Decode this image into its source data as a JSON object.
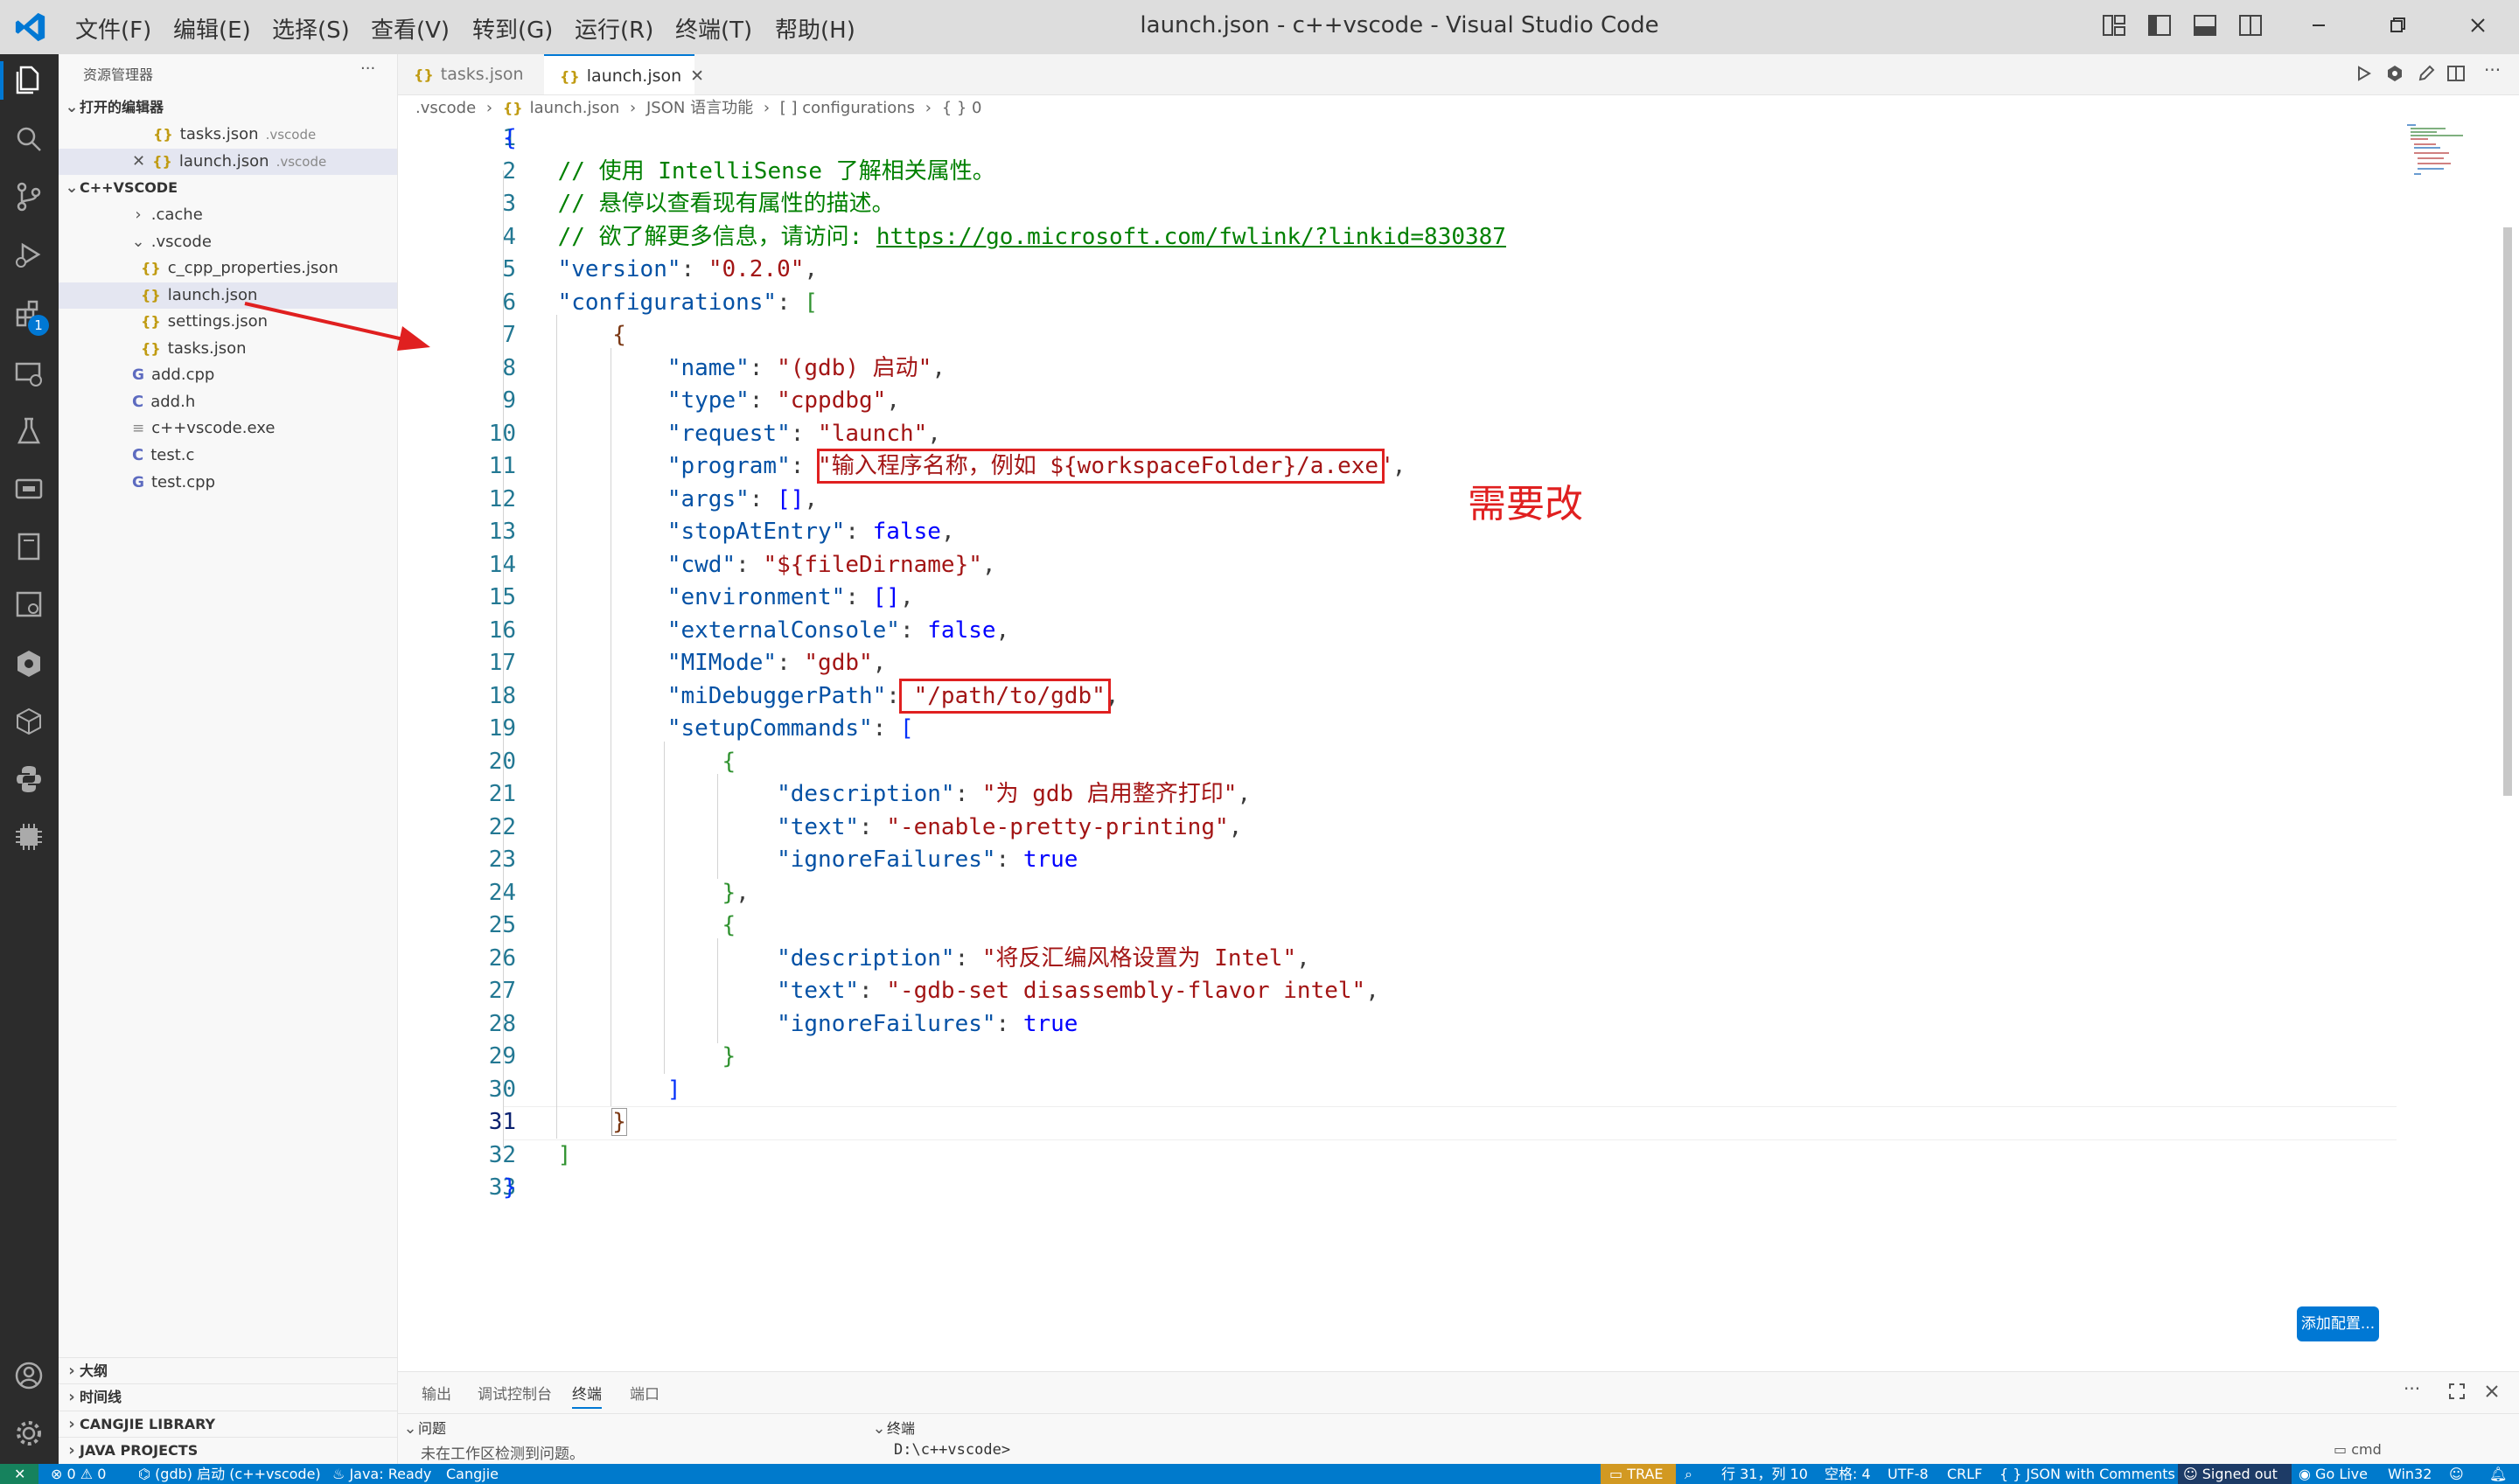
{
  "window": {
    "title": "launch.json - c++vscode - Visual Studio Code"
  },
  "menu": [
    "文件(F)",
    "编辑(E)",
    "选择(S)",
    "查看(V)",
    "转到(G)",
    "运行(R)",
    "终端(T)",
    "帮助(H)"
  ],
  "activity": {
    "extensions_badge": "1"
  },
  "sidebar": {
    "title": "资源管理器",
    "more": "···",
    "open_editors_label": "打开的编辑器",
    "open_editors": [
      {
        "name": "tasks.json",
        "desc": ".vscode"
      },
      {
        "name": "launch.json",
        "desc": ".vscode",
        "close": "✕"
      }
    ],
    "workspace_label": "C++VSCODE",
    "tree": [
      ".cache",
      ".vscode",
      "c_cpp_properties.json",
      "launch.json",
      "settings.json",
      "tasks.json",
      "add.cpp",
      "add.h",
      "c++vscode.exe",
      "test.c",
      "test.cpp"
    ],
    "bottom_sections": [
      "大纲",
      "时间线",
      "CANGJIE LIBRARY",
      "JAVA PROJECTS"
    ]
  },
  "tabs": [
    {
      "label": "tasks.json"
    },
    {
      "label": "launch.json",
      "close": "✕"
    }
  ],
  "breadcrumb": [
    ".vscode",
    "launch.json",
    "JSON 语言功能",
    "[ ] configurations",
    "{ } 0"
  ],
  "editor": {
    "line_numbers": [
      "1",
      "2",
      "3",
      "4",
      "5",
      "6",
      "7",
      "8",
      "9",
      "10",
      "11",
      "12",
      "13",
      "14",
      "15",
      "16",
      "17",
      "18",
      "19",
      "20",
      "21",
      "22",
      "23",
      "24",
      "25",
      "26",
      "27",
      "28",
      "29",
      "30",
      "31",
      "32",
      "33"
    ],
    "annotation": "需要改",
    "add_config": "添加配置..."
  },
  "code": {
    "l1": "{",
    "c2": "// 使用 IntelliSense 了解相关属性。",
    "c3": "// 悬停以查看现有属性的描述。",
    "c4": "// 欲了解更多信息，请访问: ",
    "url4": "https://go.microsoft.com/fwlink/?linkid=830387",
    "k_version": "\"version\"",
    "v_version": "\"0.2.0\"",
    "k_configurations": "\"configurations\"",
    "k_name": "\"name\"",
    "v_name": "\"(gdb) 启动\"",
    "k_type": "\"type\"",
    "v_type": "\"cppdbg\"",
    "k_request": "\"request\"",
    "v_request": "\"launch\"",
    "k_program": "\"program\"",
    "v_program_q": "\"",
    "v_program": "输入程序名称，例如 ${workspaceFolder}/a.exe",
    "k_args": "\"args\"",
    "k_stopAtEntry": "\"stopAtEntry\"",
    "v_false": "false",
    "k_cwd": "\"cwd\"",
    "v_cwd": "\"${fileDirname}\"",
    "k_environment": "\"environment\"",
    "k_externalConsole": "\"externalConsole\"",
    "k_MIMode": "\"MIMode\"",
    "v_MIMode": "\"gdb\"",
    "k_miDebuggerPath": "\"miDebuggerPath\"",
    "v_miDebuggerPath": "\"/path/to/gdb\"",
    "k_setupCommands": "\"setupCommands\"",
    "k_description": "\"description\"",
    "v_desc1": "\"为 gdb 启用整齐打印\"",
    "k_text": "\"text\"",
    "v_text1": "\"-enable-pretty-printing\"",
    "k_ignoreFailures": "\"ignoreFailures\"",
    "v_true": "true",
    "v_desc2": "\"将反汇编风格设置为 Intel\"",
    "v_text2": "\"-gdb-set disassembly-flavor intel\""
  },
  "panel": {
    "tabs": [
      "输出",
      "调试控制台",
      "终端",
      "端口"
    ],
    "problems_label": "问题",
    "problems_text": "未在工作区检测到问题。",
    "terminal_label": "终端",
    "terminal_text": "D:\\c++vscode>",
    "terminal_item": "cmd"
  },
  "status": {
    "errors": "0",
    "warnings": "0",
    "debug": "(gdb) 启动 (c++vscode)",
    "java": "Java: Ready",
    "cangjie": "Cangjie",
    "trae": "TRAE",
    "position": "行 31，列 10",
    "spaces": "空格: 4",
    "encoding": "UTF-8",
    "eol": "CRLF",
    "language": "JSON with Comments",
    "signed": "Signed out",
    "golive": "Go Live",
    "platform": "Win32"
  },
  "colors": {
    "accent": "#0078d4",
    "statusbar": "#007acc",
    "highlight": "#e02020"
  }
}
